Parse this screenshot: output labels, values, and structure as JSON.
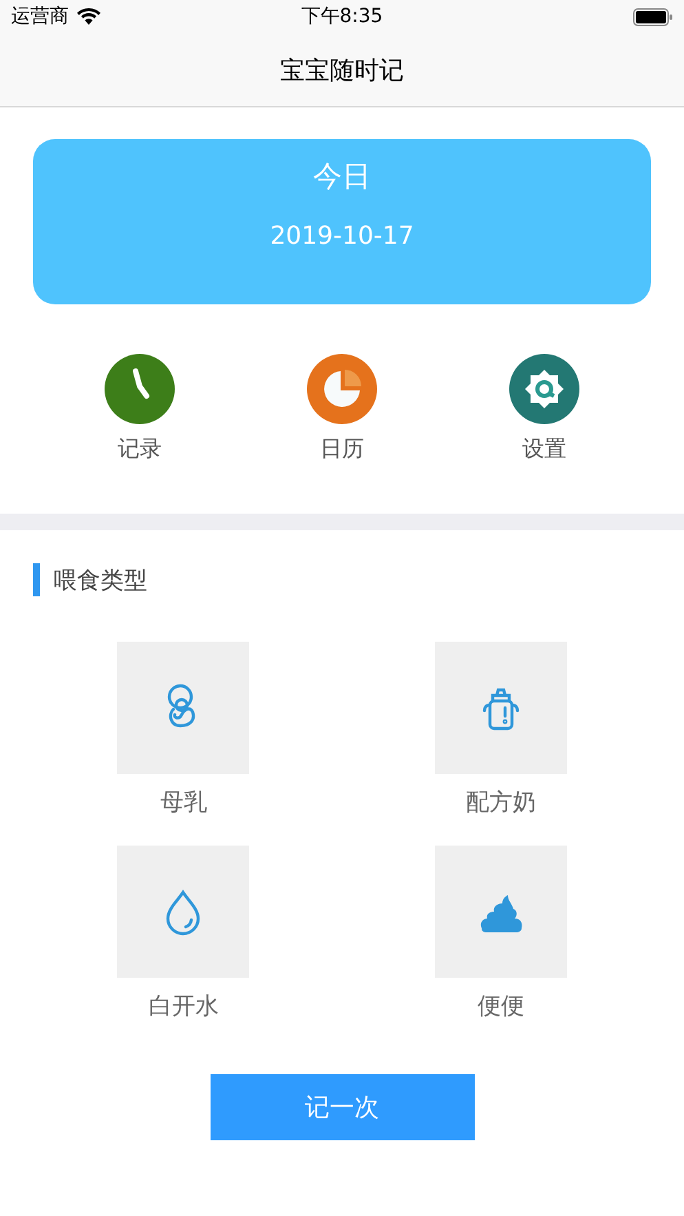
{
  "status_bar": {
    "carrier": "运营商",
    "time": "下午8:35"
  },
  "nav": {
    "title": "宝宝随时记"
  },
  "date_card": {
    "title": "今日",
    "date": "2019-10-17"
  },
  "shortcuts": [
    {
      "kind": "clock",
      "label": "记录",
      "color": "#3d7e19"
    },
    {
      "kind": "pie",
      "label": "日历",
      "color": "#e5721c"
    },
    {
      "kind": "gear",
      "label": "设置",
      "color": "#237873"
    }
  ],
  "section": {
    "title": "喂食类型"
  },
  "feed_types": [
    {
      "kind": "breast",
      "label": "母乳"
    },
    {
      "kind": "bottle",
      "label": "配方奶"
    },
    {
      "kind": "water",
      "label": "白开水"
    },
    {
      "kind": "poop",
      "label": "便便"
    }
  ],
  "record_button": "记一次"
}
